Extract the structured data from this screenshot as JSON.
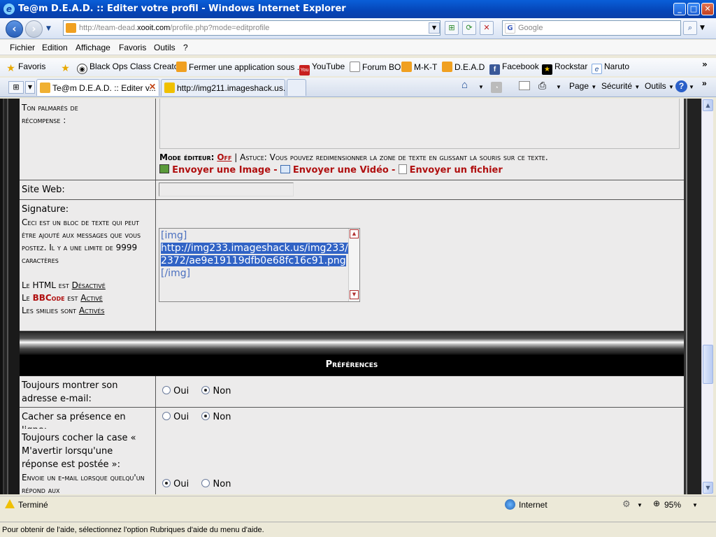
{
  "window": {
    "title": "Te@m D.E.A.D. :: Editer votre profil - Windows Internet Explorer",
    "minimize": "_",
    "maximize": "□",
    "close": "✕"
  },
  "address": {
    "url_prefix": "http://team-dead.",
    "url_domain": "xooit.com",
    "url_suffix": "/profile.php?mode=editprofile",
    "search_placeholder": "Google"
  },
  "menu": [
    "Fichier",
    "Edition",
    "Affichage",
    "Favoris",
    "Outils",
    "?"
  ],
  "favorites": {
    "label": "Favoris",
    "items": [
      "Black Ops Class Creator",
      "Fermer une application sous ...",
      "YouTube",
      "Forum BO",
      "M-K-T",
      "D.E.A.D",
      "Facebook",
      "Rockstar",
      "Naruto"
    ]
  },
  "tabs": [
    {
      "label": "Te@m D.E.A.D. :: Editer v..."
    },
    {
      "label": "http://img211.imageshack.us..."
    }
  ],
  "commandbar": {
    "page": "Page",
    "security": "Sécurité",
    "tools": "Outils"
  },
  "form": {
    "palmares_label": "Ton palmarès de récompense :",
    "editor_mode_label": "Mode éditeur:",
    "editor_mode_value": "Off",
    "tip": "| Astuce: Vous pouvez redimensionner la zone de texte en glissant la souris sur ce texte.",
    "send_image": "Envoyer une Image",
    "send_video": "Envoyer une Vidéo",
    "send_file": "Envoyer un fichier",
    "sep": "-",
    "website_label": "Site Web:",
    "signature_label": "Signature:",
    "signature_desc": "Ceci est un bloc de texte qui peut être ajouté aux messages que vous postez. Il y a une limite de 9999 caractères",
    "html_prefix": "Le HTML est",
    "html_value": "Désactivé",
    "bbcode_prefix": "Le",
    "bbcode_word": "BBCode",
    "bbcode_mid": "est",
    "bbcode_value": "Activé",
    "smilies_prefix": "Les smilies sont",
    "smilies_value": "Activés",
    "signature_open_tag": "[img]",
    "signature_url": "http://img233.imageshack.us/img233/2372/ae9e19119dfb0e68fc16c91.png",
    "signature_close_tag": "[/img]",
    "preferences_header": "Préférences",
    "show_email_label": "Toujours montrer son adresse e-mail:",
    "hide_online_label": "Cacher sa présence en ligne:",
    "notify_label": "Toujours cocher la case « M'avertir lorsqu'une réponse est postée »:",
    "notify_desc": "Envoie un e-mail lorsque quelqu'un répond aux",
    "oui": "Oui",
    "non": "Non"
  },
  "status": {
    "text": "Terminé",
    "zone": "Internet",
    "zoom": "95%"
  },
  "help": "Pour obtenir de l'aide, sélectionnez l'option Rubriques d'aide du menu d'aide."
}
